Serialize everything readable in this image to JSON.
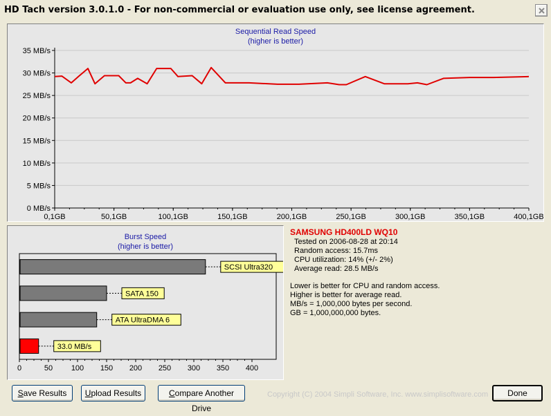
{
  "window": {
    "title": "HD Tach version 3.0.1.0  - For non-commercial or evaluation use only, see license agreement."
  },
  "sequential": {
    "title": "Sequential Read Speed",
    "subtitle": "(higher is better)"
  },
  "burst": {
    "title": "Burst Speed",
    "subtitle": "(higher is better)"
  },
  "info": {
    "drive_name": "SAMSUNG HD400LD WQ10",
    "lines": [
      "Tested on 2006-08-28 at 20:14",
      "Random access: 15.7ms",
      "CPU utilization: 14% (+/- 2%)",
      "Average read: 28.5 MB/s"
    ],
    "notes": [
      "Lower is better for CPU and random access.",
      "Higher is better for average read.",
      "MB/s = 1,000,000 bytes per second.",
      "GB = 1,000,000,000 bytes."
    ]
  },
  "buttons": {
    "save_pre": "",
    "save_ul": "S",
    "save_post": "ave Results",
    "upload_pre": "",
    "upload_ul": "U",
    "upload_post": "pload Results",
    "compare_pre": "",
    "compare_ul": "C",
    "compare_post": "ompare Another Drive",
    "done_label": "Done"
  },
  "copyright": "Copyright (C) 2004 Simpli Software, Inc. www.simplisoftware.com",
  "colors": {
    "seq_line": "#e00000",
    "burst_bar": "#7a7a7a",
    "burst_highlight": "#ff0000",
    "label_bg": "#ffff99"
  },
  "chart_data": [
    {
      "type": "line",
      "title": "Sequential Read Speed",
      "subtitle": "(higher is better)",
      "xlim": [
        0,
        400
      ],
      "ylim": [
        0,
        35
      ],
      "x_ticks": [
        "0,1GB",
        "50,1GB",
        "100,1GB",
        "150,1GB",
        "200,1GB",
        "250,1GB",
        "300,1GB",
        "350,1GB",
        "400,1GB"
      ],
      "y_ticks": [
        "0 MB/s",
        "5 MB/s",
        "10 MB/s",
        "15 MB/s",
        "20 MB/s",
        "25 MB/s",
        "30 MB/s",
        "35 MB/s"
      ],
      "x": [
        0,
        6,
        14,
        20,
        28,
        34,
        42,
        48,
        54,
        60,
        64,
        70,
        78,
        86,
        98,
        104,
        116,
        124,
        132,
        144,
        164,
        188,
        206,
        230,
        240,
        246,
        262,
        278,
        298,
        306,
        314,
        328,
        350,
        370,
        400
      ],
      "y": [
        29.2,
        29.3,
        27.8,
        29.2,
        31.0,
        27.6,
        29.4,
        29.4,
        29.4,
        27.8,
        27.8,
        28.8,
        27.6,
        31.0,
        31.0,
        29.2,
        29.4,
        27.6,
        31.2,
        27.8,
        27.8,
        27.5,
        27.5,
        27.8,
        27.4,
        27.4,
        29.2,
        27.6,
        27.6,
        27.8,
        27.4,
        28.8,
        29.0,
        29.0,
        29.2
      ]
    },
    {
      "type": "bar",
      "orientation": "horizontal",
      "title": "Burst Speed",
      "subtitle": "(higher is better)",
      "xlim": [
        0,
        400
      ],
      "x_ticks": [
        "0",
        "50",
        "100",
        "150",
        "200",
        "250",
        "300",
        "350",
        "400"
      ],
      "categories": [
        "SCSI Ultra320",
        "SATA 150",
        "ATA UltraDMA 6",
        "33.0 MB/s"
      ],
      "values": [
        320,
        150,
        133,
        33.0
      ],
      "highlight_index": 3
    }
  ]
}
